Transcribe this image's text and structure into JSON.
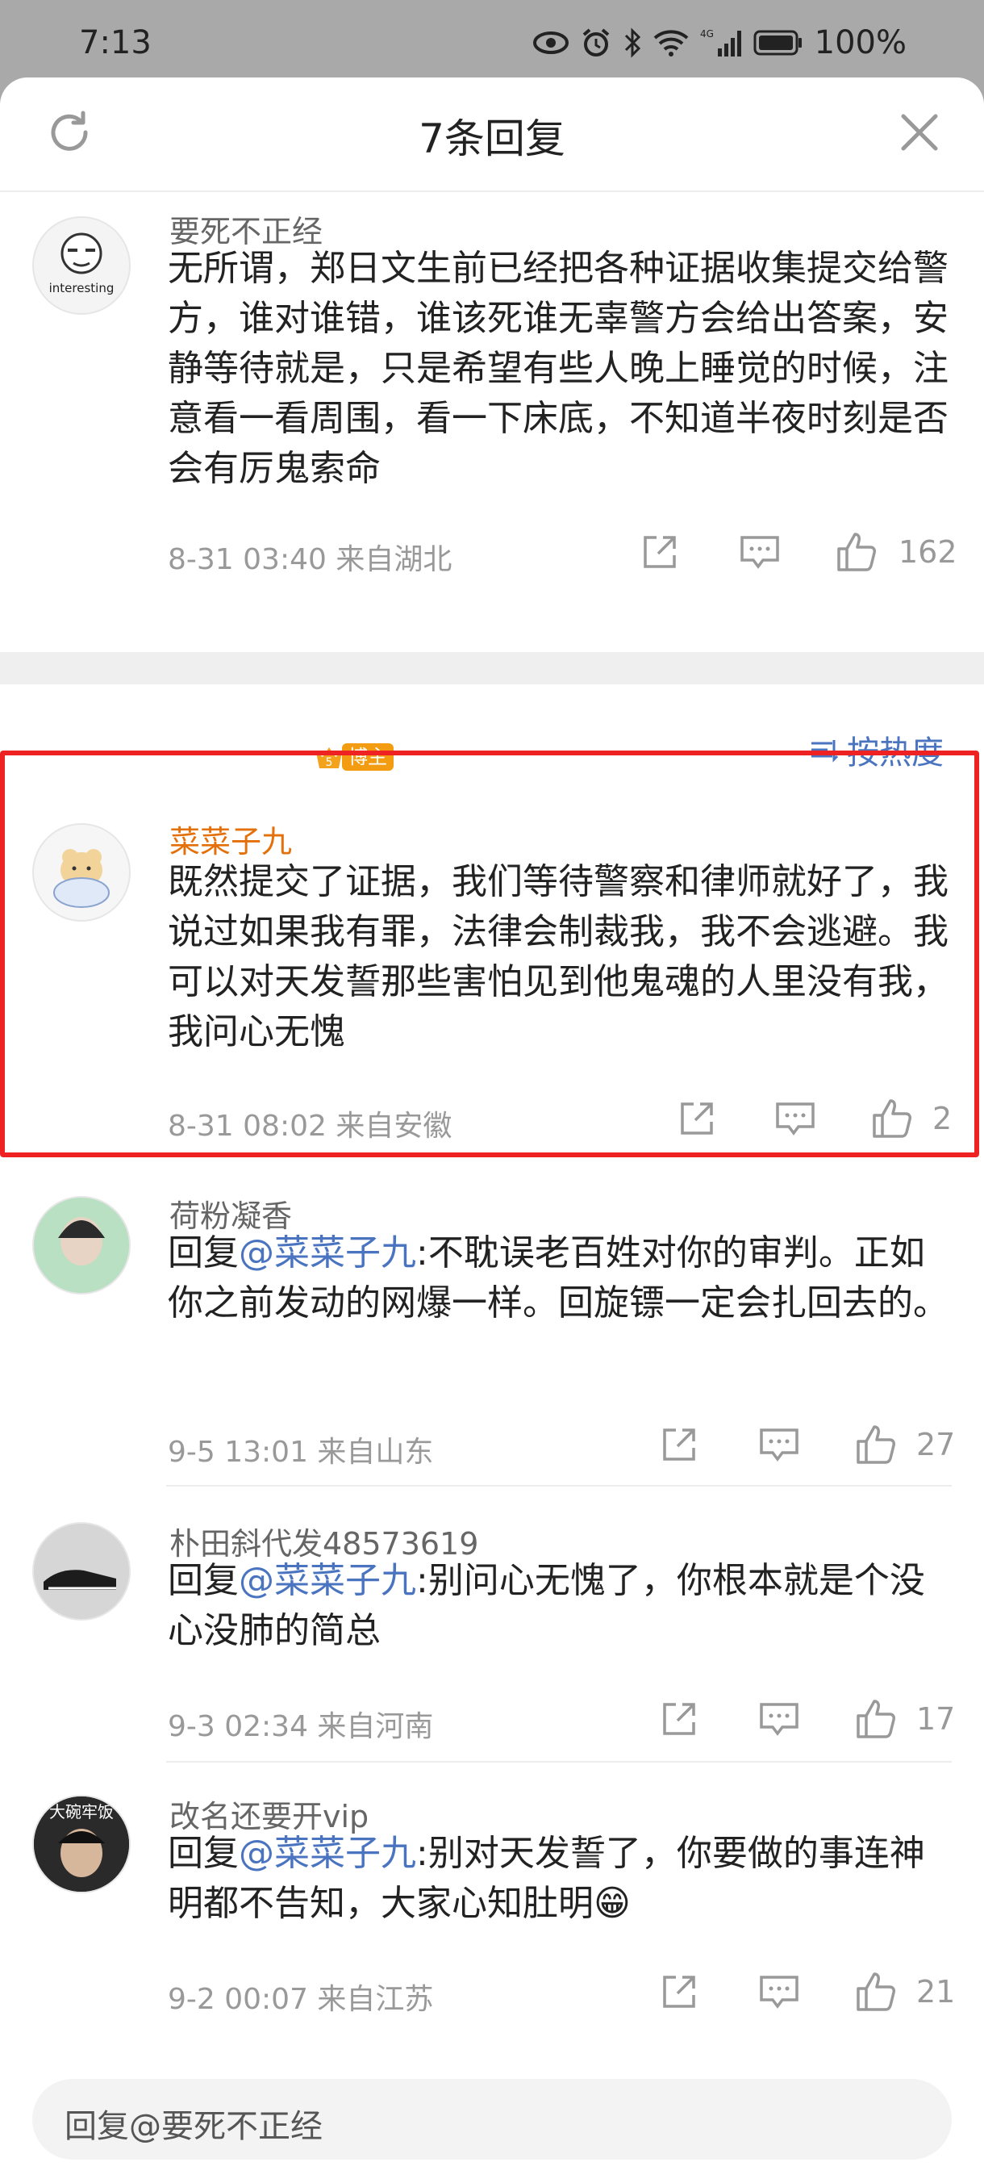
{
  "status_bar": {
    "time": "7:13",
    "battery": "100%",
    "network": "4G"
  },
  "header": {
    "title": "7条回复",
    "refresh_icon": "refresh-icon",
    "close_icon": "close-icon"
  },
  "root_comment": {
    "user": "要死不正经",
    "avatar_text": "interesting",
    "text": "无所谓，郑日文生前已经把各种证据收集提交给警方，谁对谁错，谁该死谁无辜警方会给出答案，安静等待就是，只是希望有些人晚上睡觉的时候，注意看一看周围，看一下床底，不知道半夜时刻是否会有厉鬼索命",
    "meta": "8-31 03:40  来自湖北",
    "likes": "162"
  },
  "sort_label": "按热度",
  "replies": [
    {
      "user": "菜菜子九",
      "badge_level": "5",
      "badge": "博主",
      "text": "既然提交了证据，我们等待警察和律师就好了，我说过如果我有罪，法律会制裁我，我不会逃避。我可以对天发誓那些害怕见到他鬼魂的人里没有我，我问心无愧",
      "meta": "8-31 08:02  来自安徽",
      "likes": "2"
    },
    {
      "user": "荷粉凝香",
      "reply_prefix": "回复",
      "mention": "@菜菜子九",
      "text": ":不耽误老百姓对你的审判。正如你之前发动的网爆一样。回旋镖一定会扎回去的。",
      "meta": "9-5 13:01  来自山东",
      "likes": "27"
    },
    {
      "user": "朴田斜代发48573619",
      "reply_prefix": "回复",
      "mention": "@菜菜子九",
      "text": ":别问心无愧了，你根本就是个没心没肺的简总",
      "meta": "9-3 02:34  来自河南",
      "likes": "17"
    },
    {
      "user": "改名还要开vip",
      "avatar_text": "大碗牢饭",
      "reply_prefix": "回复",
      "mention": "@菜菜子九",
      "text": ":别对天发誓了，你要做的事连神明都不告知，大家心知肚明",
      "emoji": "😁",
      "meta": "9-2 00:07  来自江苏",
      "likes": "21"
    }
  ],
  "reply_input": {
    "placeholder": "回复@要死不正经"
  },
  "colors": {
    "accent": "#4a74c0",
    "username_highlight": "#e3700a",
    "highlight_border": "#ee2222"
  }
}
